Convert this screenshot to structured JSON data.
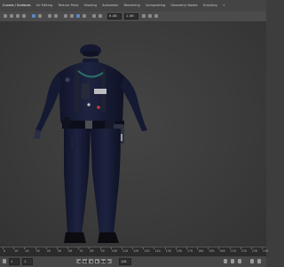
{
  "menu_tabs": [
    {
      "label": "Curves / Surfaces"
    },
    {
      "label": "UV Editing"
    },
    {
      "label": "Texture Paint"
    },
    {
      "label": "Shading"
    },
    {
      "label": "Animation"
    },
    {
      "label": "Rendering"
    },
    {
      "label": "Compositing"
    },
    {
      "label": "Geometry Nodes"
    },
    {
      "label": "Scripting"
    },
    {
      "label": "+"
    }
  ],
  "toolbar": {
    "value_a": "0.00",
    "value_b": "1.00"
  },
  "timeline": {
    "ticks": [
      "0",
      "10",
      "20",
      "30",
      "40",
      "50",
      "60",
      "70",
      "80",
      "90",
      "100",
      "110",
      "120",
      "130",
      "140",
      "150",
      "160",
      "170",
      "180",
      "190",
      "200",
      "210",
      "220",
      "230",
      "240"
    ]
  },
  "playback": {
    "start_frame": "1",
    "current_frame": "1",
    "end_frame": "120",
    "buttons": [
      "|◀",
      "◀◀",
      "◀",
      "▶",
      "▶▶",
      "▶|"
    ]
  },
  "colors": {
    "uniform": "#1b2036",
    "uniform_dark": "#121528",
    "viewport_bg": "#3d3d3d"
  }
}
